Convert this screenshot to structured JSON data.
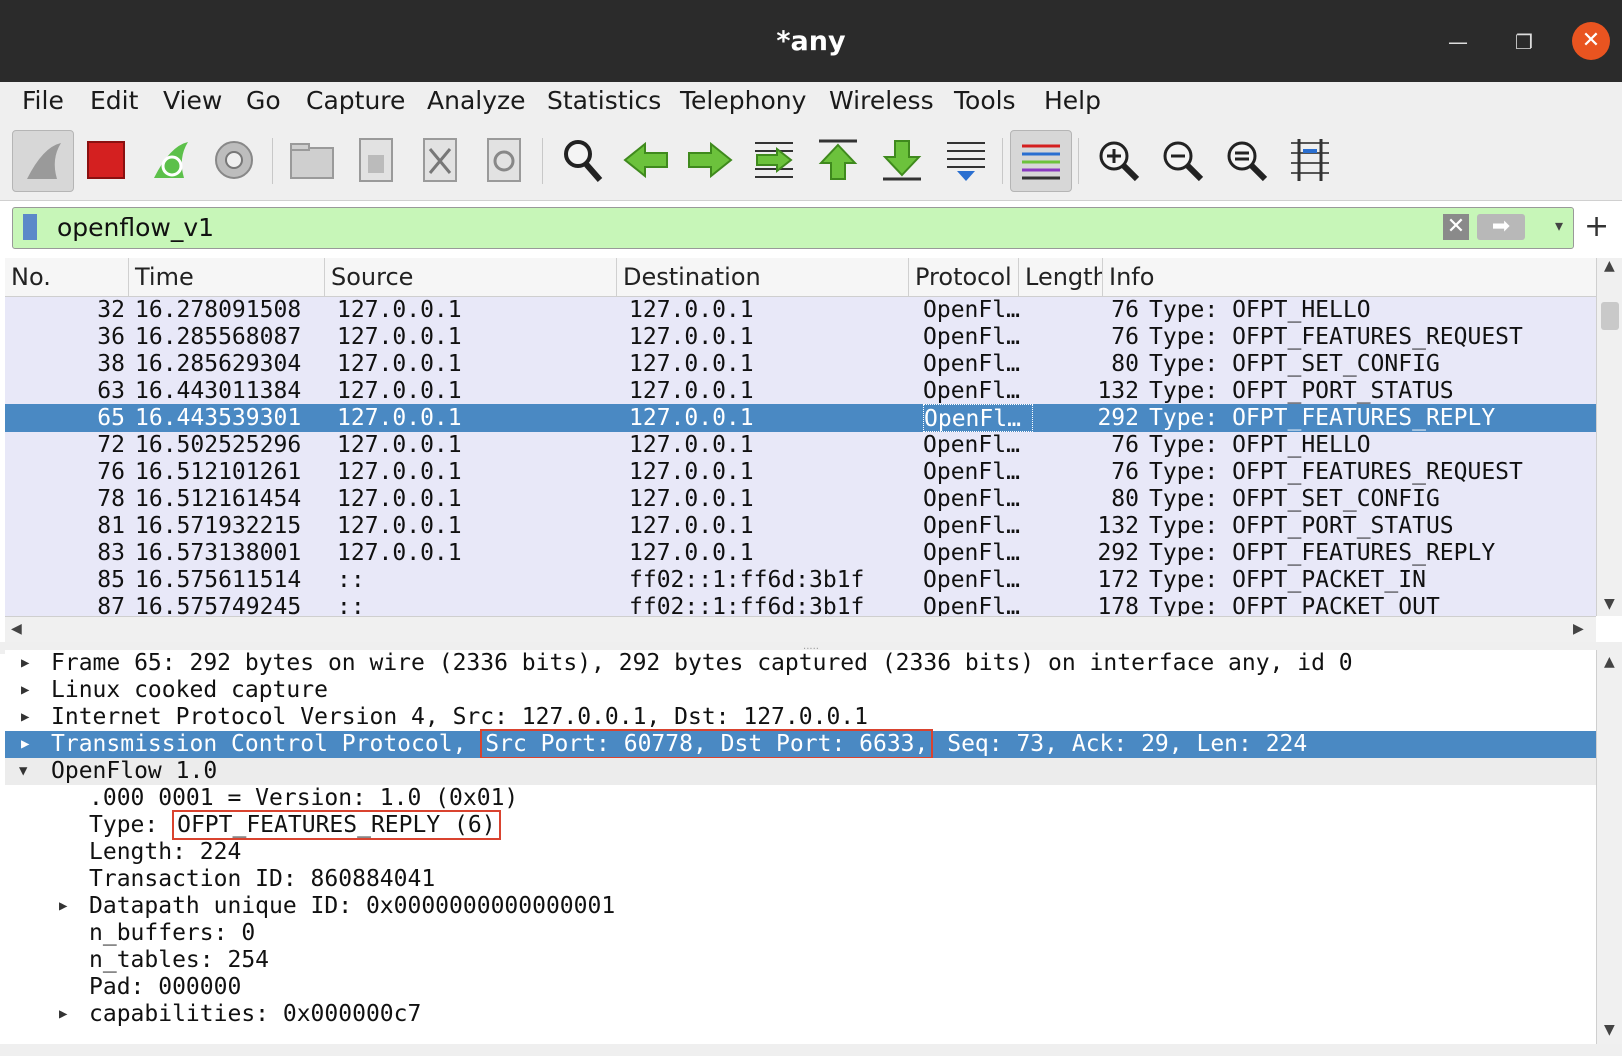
{
  "window": {
    "title": "*any",
    "minimize_glyph": "—",
    "maximize_glyph": "❐",
    "close_glyph": "✕"
  },
  "menu": [
    "File",
    "Edit",
    "View",
    "Go",
    "Capture",
    "Analyze",
    "Statistics",
    "Telephony",
    "Wireless",
    "Tools",
    "Help"
  ],
  "toolbar_icons": [
    "shark-fin-start-icon",
    "stop-capture-icon",
    "restart-capture-icon",
    "capture-options-icon",
    "open-file-icon",
    "save-file-icon",
    "close-file-icon",
    "reload-file-icon",
    "find-packet-icon",
    "go-back-icon",
    "go-forward-icon",
    "go-to-packet-icon",
    "go-first-icon",
    "go-last-icon",
    "autoscroll-icon",
    "colorize-icon",
    "zoom-in-icon",
    "zoom-out-icon",
    "zoom-normal-icon",
    "resize-columns-icon"
  ],
  "filter": {
    "value": "openflow_v1",
    "clear_glyph": "✕",
    "apply_glyph": "➡",
    "dropdown_glyph": "▾",
    "add_glyph": "+"
  },
  "packet_list": {
    "columns": [
      "No.",
      "Time",
      "Source",
      "Destination",
      "Protocol",
      "Length",
      "Info"
    ],
    "rows": [
      {
        "no": "32",
        "time": "16.278091508",
        "src": "127.0.0.1",
        "dst": "127.0.0.1",
        "proto": "OpenFl…",
        "len": "76",
        "info": "Type: OFPT_HELLO"
      },
      {
        "no": "36",
        "time": "16.285568087",
        "src": "127.0.0.1",
        "dst": "127.0.0.1",
        "proto": "OpenFl…",
        "len": "76",
        "info": "Type: OFPT_FEATURES_REQUEST"
      },
      {
        "no": "38",
        "time": "16.285629304",
        "src": "127.0.0.1",
        "dst": "127.0.0.1",
        "proto": "OpenFl…",
        "len": "80",
        "info": "Type: OFPT_SET_CONFIG"
      },
      {
        "no": "63",
        "time": "16.443011384",
        "src": "127.0.0.1",
        "dst": "127.0.0.1",
        "proto": "OpenFl…",
        "len": "132",
        "info": "Type: OFPT_PORT_STATUS"
      },
      {
        "no": "65",
        "time": "16.443539301",
        "src": "127.0.0.1",
        "dst": "127.0.0.1",
        "proto": "OpenFl…",
        "len": "292",
        "info": "Type: OFPT_FEATURES_REPLY"
      },
      {
        "no": "72",
        "time": "16.502525296",
        "src": "127.0.0.1",
        "dst": "127.0.0.1",
        "proto": "OpenFl…",
        "len": "76",
        "info": "Type: OFPT_HELLO"
      },
      {
        "no": "76",
        "time": "16.512101261",
        "src": "127.0.0.1",
        "dst": "127.0.0.1",
        "proto": "OpenFl…",
        "len": "76",
        "info": "Type: OFPT_FEATURES_REQUEST"
      },
      {
        "no": "78",
        "time": "16.512161454",
        "src": "127.0.0.1",
        "dst": "127.0.0.1",
        "proto": "OpenFl…",
        "len": "80",
        "info": "Type: OFPT_SET_CONFIG"
      },
      {
        "no": "81",
        "time": "16.571932215",
        "src": "127.0.0.1",
        "dst": "127.0.0.1",
        "proto": "OpenFl…",
        "len": "132",
        "info": "Type: OFPT_PORT_STATUS"
      },
      {
        "no": "83",
        "time": "16.573138001",
        "src": "127.0.0.1",
        "dst": "127.0.0.1",
        "proto": "OpenFl…",
        "len": "292",
        "info": "Type: OFPT_FEATURES_REPLY"
      },
      {
        "no": "85",
        "time": "16.575611514",
        "src": "::",
        "dst": "ff02::1:ff6d:3b1f",
        "proto": "OpenFl…",
        "len": "172",
        "info": "Type: OFPT_PACKET_IN"
      },
      {
        "no": "87",
        "time": "16.575749245",
        "src": "::",
        "dst": "ff02::1:ff6d:3b1f",
        "proto": "OpenFl…",
        "len": "178",
        "info": "Type: OFPT_PACKET_OUT"
      }
    ],
    "selected_no": "65"
  },
  "details": {
    "frame": "Frame 65: 292 bytes on wire (2336 bits), 292 bytes captured (2336 bits) on interface any, id 0",
    "linux": "Linux cooked capture",
    "ip": "Internet Protocol Version 4, Src: 127.0.0.1, Dst: 127.0.0.1",
    "tcp_pre": "Transmission Control Protocol, ",
    "tcp_ports": "Src Port: 60778, Dst Port: 6633,",
    "tcp_post": " Seq: 73, Ack: 29, Len: 224",
    "openflow": "OpenFlow 1.0",
    "version": ".000 0001 = Version: 1.0 (0x01)",
    "type_label": "Type: ",
    "type_value": "OFPT_FEATURES_REPLY (6)",
    "length": "Length: 224",
    "xid": "Transaction ID: 860884041",
    "dpid": "Datapath unique ID: 0x0000000000000001",
    "n_buffers": "n_buffers: 0",
    "n_tables": "n_tables: 254",
    "pad": "Pad: 000000",
    "capabilities": "capabilities: 0x000000c7"
  },
  "colors": {
    "selection": "#4a89c3",
    "row_bg": "#e8e8f8",
    "filter_bg": "#c7f6b8",
    "highlight_box": "#d9432f",
    "close_button": "#e95420"
  }
}
